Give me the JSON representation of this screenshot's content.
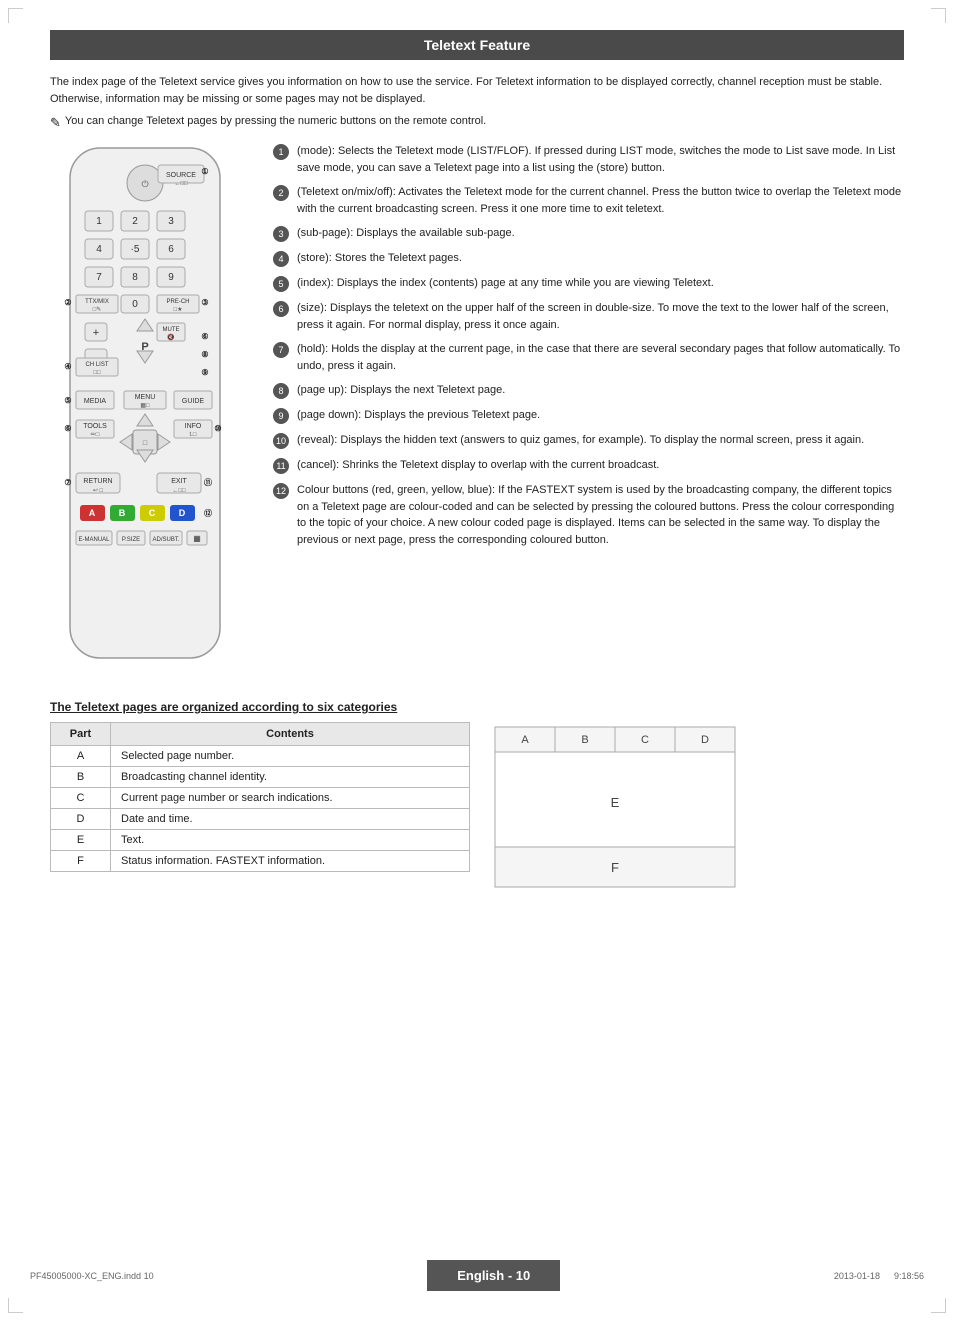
{
  "page": {
    "title": "Teletext Feature",
    "intro": "The index page of the Teletext service gives you information on how to use the service. For Teletext information to be displayed correctly, channel reception must be stable. Otherwise, information may be missing or some pages may not be displayed.",
    "note": "You can change Teletext pages by pressing the numeric buttons on the remote control.",
    "items": [
      {
        "num": "1",
        "text": "(mode): Selects the Teletext mode (LIST/FLOF). If pressed during LIST mode, switches the mode to List save mode. In List save mode, you can save a Teletext page into a list using the (store) button."
      },
      {
        "num": "2",
        "text": "(Teletext on/mix/off): Activates the Teletext mode for the current channel. Press the button twice to overlap the Teletext mode with the current broadcasting screen. Press it one more time to exit teletext."
      },
      {
        "num": "3",
        "text": "(sub-page): Displays the available sub-page."
      },
      {
        "num": "4",
        "text": "(store): Stores the Teletext pages."
      },
      {
        "num": "5",
        "text": "(index): Displays the index (contents) page at any time while you are viewing Teletext."
      },
      {
        "num": "6",
        "text": "(size): Displays the teletext on the upper half of the screen in double-size. To move the text to the lower half of the screen, press it again. For normal display, press it once again."
      },
      {
        "num": "7",
        "text": "(hold): Holds the display at the current page, in the case that there are several secondary pages that follow automatically. To undo, press it again."
      },
      {
        "num": "8",
        "text": "(page up): Displays the next Teletext page."
      },
      {
        "num": "9",
        "text": "(page down): Displays the previous Teletext page."
      },
      {
        "num": "10",
        "text": "(reveal): Displays the hidden text (answers to quiz games, for example). To display the normal screen, press it again."
      },
      {
        "num": "11",
        "text": "(cancel): Shrinks the Teletext display to overlap with the current broadcast."
      },
      {
        "num": "12",
        "text": "Colour buttons (red, green, yellow, blue): If the FASTEXT system is used by the broadcasting company, the different topics on a Teletext page are colour-coded and can be selected by pressing the coloured buttons. Press the colour corresponding to the topic of your choice. A new colour coded page is displayed. Items can be selected in the same way. To display the previous or next page, press the corresponding coloured button."
      }
    ],
    "table_section": {
      "title": "The Teletext pages are organized according to six categories",
      "headers": [
        "Part",
        "Contents"
      ],
      "rows": [
        [
          "A",
          "Selected page number."
        ],
        [
          "B",
          "Broadcasting channel identity."
        ],
        [
          "C",
          "Current page number or search indications."
        ],
        [
          "D",
          "Date and time."
        ],
        [
          "E",
          "Text."
        ],
        [
          "F",
          "Status information. FASTEXT information."
        ]
      ]
    },
    "footer": {
      "left": "PF45005000-XC_ENG.indd  10",
      "center": "English - 10",
      "right": "2013-01-18    9:18:56"
    }
  }
}
